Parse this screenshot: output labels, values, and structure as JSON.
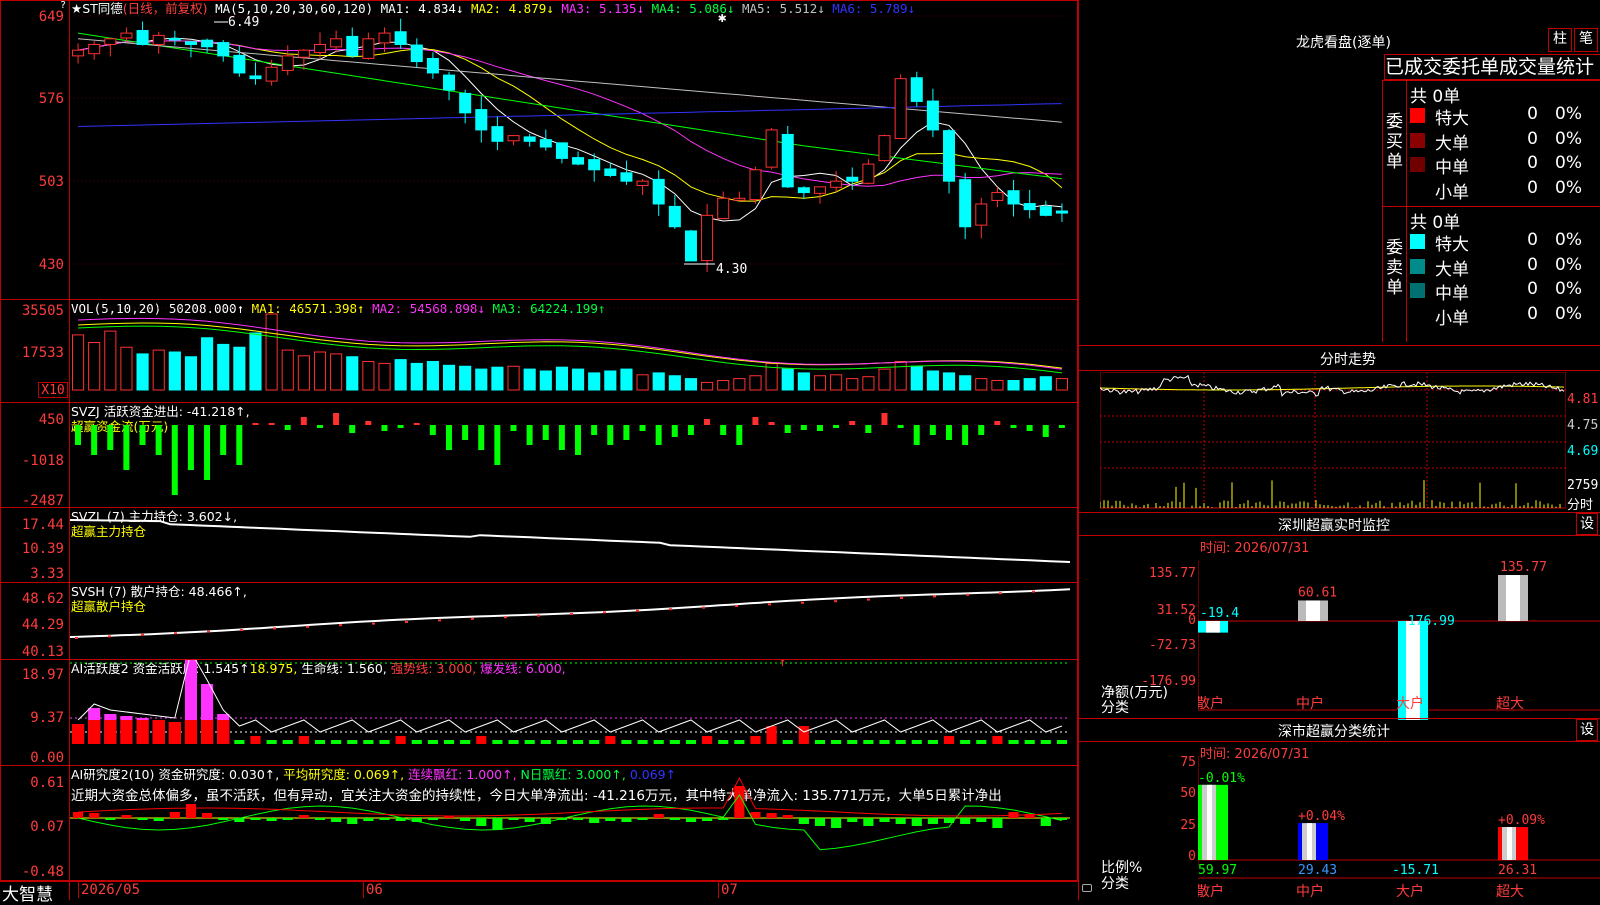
{
  "main": {
    "title": "★ST同德",
    "period": "(日线，前复权)",
    "ma_label": "MA(5,10,20,30,60,120)",
    "ma1": "MA1: 4.834↓",
    "ma2": "MA2: 4.879↓",
    "ma3": "MA3: 5.135↓",
    "ma4": "MA4: 5.086↓",
    "ma5": "MA5: 5.512↓",
    "ma6": "MA6: 5.789↓",
    "high_mark": "6.49",
    "low_mark": "4.30",
    "yticks": [
      "649",
      "576",
      "503",
      "430"
    ],
    "colors": {
      "up": "#ff3030",
      "down": "#00ffff",
      "ma1": "#ffffff",
      "ma2": "#ffff00",
      "ma3": "#ff33ff",
      "ma4": "#00ff00",
      "ma5": "#c0c0c0",
      "ma6": "#3333ff"
    }
  },
  "vol": {
    "label": "VOL(5,10,20)",
    "value": "50208.000↑",
    "ma1": "MA1: 46571.398↑",
    "ma2": "MA2: 54568.898↓",
    "ma3": "MA3: 64224.199↑",
    "yticks": [
      "35505",
      "17533"
    ],
    "unit": "X10"
  },
  "svzj": {
    "label": "SVZJ  活跃资金进出: -41.218↑,",
    "sub": "超赢资金流(万元)",
    "yticks": [
      "450",
      "-1018",
      "-2487"
    ]
  },
  "svzl": {
    "label": "SVZL (7) 主力持仓: 3.602↓,",
    "sub": "超赢主力持仓",
    "yticks": [
      "17.44",
      "10.39",
      "3.33"
    ]
  },
  "svsh": {
    "label": "SVSH (7) 散户持仓: 48.466↑,",
    "sub": "超赢散户持仓",
    "yticks": [
      "48.62",
      "44.29",
      "40.13"
    ]
  },
  "ai1": {
    "label": "AI活跃度2 资金活跃度: 1.545↑",
    "v2": "18.975,",
    "v3": "生命线: 1.560,",
    "v4": "强势线: 3.000,",
    "v5": "爆发线: 6.000,",
    "yticks": [
      "18.97",
      "9.37",
      "0.00"
    ]
  },
  "ai2": {
    "label": "AI研究度2(10) 资金研究度: 0.030↑,",
    "v2": "平均研究度: 0.069↑,",
    "v3": "连续飘红: 1.000↑,",
    "v4": "N日飘红: 3.000↑,",
    "v5": "0.069↑",
    "desc": "近期大资金总体偏多，虽不活跃，但有异动，宜关注大资金的持续性，今日大单净流出: -41.216万元，其中特大单净流入: 135.771万元，大单5日累计净出",
    "yticks": [
      "0.61",
      "0.07",
      "-0.48"
    ]
  },
  "xaxis": {
    "brand": "大智慧",
    "labels": [
      "2026/05",
      "06",
      "07"
    ]
  },
  "dragon": {
    "title": "龙虎看盘(逐单)",
    "btn1": "柱",
    "btn2": "笔",
    "tabs": "已成交委托单成交量统计",
    "buy_label": "委买单",
    "sell_label": "委卖单",
    "buy_total": "共 0单",
    "sell_total": "共 0单",
    "buy_rows": [
      {
        "name": "特大",
        "count": "0",
        "pct": "0%",
        "color": "#ff0000"
      },
      {
        "name": "大单",
        "count": "0",
        "pct": "0%",
        "color": "#8b0000"
      },
      {
        "name": "中单",
        "count": "0",
        "pct": "0%",
        "color": "#700000"
      },
      {
        "name": "小单",
        "count": "0",
        "pct": "0%",
        "color": ""
      }
    ],
    "sell_rows": [
      {
        "name": "特大",
        "count": "0",
        "pct": "0%",
        "color": "#00ffff"
      },
      {
        "name": "大单",
        "count": "0",
        "pct": "0%",
        "color": "#008b8b"
      },
      {
        "name": "中单",
        "count": "0",
        "pct": "0%",
        "color": "#007070"
      },
      {
        "name": "小单",
        "count": "0",
        "pct": "0%",
        "color": ""
      }
    ]
  },
  "intraday": {
    "title": "分时走势",
    "ylabels": [
      "4.81",
      "4.75",
      "4.69"
    ],
    "vol_label": "2759",
    "vol_unit": "分时"
  },
  "sz_monitor": {
    "title": "深圳超赢实时监控",
    "set": "设",
    "time": "时间: 2026/07/31",
    "yticks": [
      "135.77",
      "31.52",
      "0",
      "-72.73",
      "-176.99"
    ],
    "axis_title": "净额(万元)",
    "axis_sub": "分类",
    "categories": [
      "散户",
      "中户",
      "大户",
      "超大"
    ],
    "values": [
      -19.4,
      60.61,
      -176.99,
      135.77
    ],
    "value_labels": [
      "-19.4",
      "60.61",
      "-176.99",
      "135.77"
    ]
  },
  "sz_class": {
    "title": "深市超赢分类统计",
    "set": "设",
    "time": "时间: 2026/07/31",
    "yticks": [
      "75",
      "50",
      "25",
      "0"
    ],
    "axis_title": "比例%",
    "axis_sub": "分类",
    "categories": [
      "散户",
      "中户",
      "大户",
      "超大"
    ],
    "values": [
      59.97,
      29.43,
      -15.71,
      26.31
    ],
    "value_labels": [
      "59.97",
      "29.43",
      "-15.71",
      "26.31"
    ],
    "change_labels": [
      "-0.01%",
      "+0.04%",
      "",
      "+0.09%"
    ]
  }
}
